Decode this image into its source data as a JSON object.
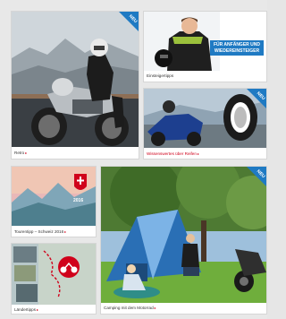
{
  "tiles": {
    "retro": {
      "caption": "Retro",
      "badge": "NEU"
    },
    "einsteiger": {
      "caption": "Einsteigertipps",
      "banner_line1": "FÜR ANFÄNGER UND",
      "banner_line2": "WIEDEREINSTEIGER"
    },
    "reifen": {
      "caption": "Wissenswertes über Reifen",
      "badge": "NEU"
    },
    "tourentipp": {
      "caption": "Tourentipp – Schweiz 2016",
      "year": "2016"
    },
    "laendertipps": {
      "caption": "Ländertipps"
    },
    "camping": {
      "caption": "Camping mit dem Motorrad",
      "badge": "NEU"
    }
  },
  "colors": {
    "accent_blue": "#1f7ac3",
    "caption_red": "#d0021b"
  }
}
